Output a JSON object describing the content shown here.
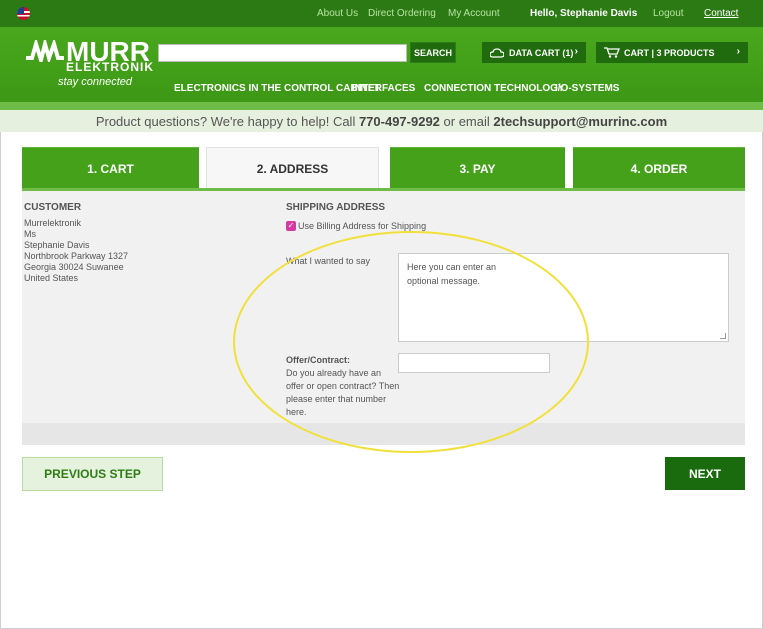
{
  "topbar": {
    "flag_icon": "us-flag-icon",
    "links": {
      "about": "About Us",
      "direct_ordering": "Direct Ordering",
      "my_account": "My Account",
      "hello": "Hello, Stephanie Davis",
      "logout": "Logout",
      "contact": "Contact"
    }
  },
  "header": {
    "logo": {
      "brand": "MURR",
      "sub": "ELEKTRONIK",
      "tagline": "stay connected"
    },
    "search": {
      "value": "",
      "button": "SEARCH"
    },
    "data_cart": {
      "label": "DATA CART (1)",
      "icon": "cloud-icon",
      "chevron": "›"
    },
    "cart": {
      "label": "CART | 3 PRODUCTS",
      "icon": "shopping-cart-icon",
      "chevron": "›"
    },
    "nav": [
      "ELECTRONICS IN THE CONTROL CABINET",
      "INTERFACES",
      "CONNECTION TECHNOLOGY",
      "I/O-SYSTEMS"
    ]
  },
  "help": {
    "prefix": "Product questions? We're happy to help! Call ",
    "phone": "770-497-9292",
    "middle": " or email ",
    "email": "2techsupport@murrinc.com"
  },
  "steps": [
    {
      "label": "1. CART"
    },
    {
      "label": "2. ADDRESS"
    },
    {
      "label": "3. PAY"
    },
    {
      "label": "4. ORDER"
    }
  ],
  "customer": {
    "heading": "CUSTOMER",
    "lines": [
      "Murrelektronik",
      "Ms",
      "Stephanie Davis",
      "Northbrook Parkway 1327",
      "Georgia 30024 Suwanee",
      "United States"
    ]
  },
  "shipping": {
    "heading": "SHIPPING ADDRESS",
    "checkbox_label": "Use Billing Address for Shipping",
    "checkbox_checked": true,
    "message_label": "What I wanted to say",
    "message_placeholder_1": "Here you can enter an",
    "message_placeholder_2": "optional message.",
    "offer_label": "Offer/Contract:",
    "offer_help_1": "Do you already have an",
    "offer_help_2": "offer or open contract? Then",
    "offer_help_3": "please enter that number",
    "offer_help_4": "here.",
    "offer_value": ""
  },
  "buttons": {
    "previous": "PREVIOUS STEP",
    "next": "NEXT"
  },
  "colors": {
    "brand_green": "#45a119",
    "dark_green": "#1a6a0e",
    "highlight": "#f2e03a",
    "checkbox": "#d63aa0"
  }
}
